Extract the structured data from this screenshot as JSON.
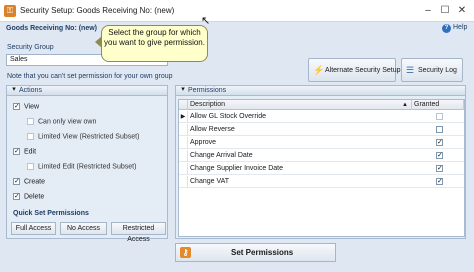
{
  "window": {
    "title": "Security Setup: Goods Receiving No: (new)",
    "app_icon": "security-app-icon",
    "controls": {
      "minimize": "–",
      "maximize": "☐",
      "close": "✕"
    }
  },
  "header": {
    "label": "Goods Receiving No: (new)",
    "help_label": "Help"
  },
  "security_group": {
    "label": "Security Group",
    "value": "Sales",
    "note": "Note that you can't set permission for your own group"
  },
  "tooltip": {
    "text": "Select the group for which you want to give permission."
  },
  "toolbar": {
    "alternate_security_label": "Alternate Security Setup",
    "security_log_label": "Security Log"
  },
  "actions": {
    "title": "Actions",
    "items": [
      {
        "label": "View",
        "checked": true
      },
      {
        "label": "Can only view own",
        "checked": false
      },
      {
        "label": "Limited View (Restricted Subset)",
        "checked": false
      },
      {
        "label": "Edit",
        "checked": true
      },
      {
        "label": "Limited Edit (Restricted Subset)",
        "checked": false
      },
      {
        "label": "Create",
        "checked": true
      },
      {
        "label": "Delete",
        "checked": true
      }
    ],
    "quick_set_label": "Quick Set Permissions",
    "quick_set_buttons": [
      "Full Access",
      "No Access",
      "Restricted Access"
    ]
  },
  "permissions": {
    "title": "Permissions",
    "columns": [
      "Description",
      "Granted"
    ],
    "rows": [
      {
        "description": "Allow GL Stock Override",
        "granted": false,
        "current": true
      },
      {
        "description": "Allow Reverse",
        "granted": false,
        "current": false
      },
      {
        "description": "Approve",
        "granted": true,
        "current": false
      },
      {
        "description": "Change Arrival Date",
        "granted": true,
        "current": false
      },
      {
        "description": "Change Supplier Invoice Date",
        "granted": true,
        "current": false
      },
      {
        "description": "Change VAT",
        "granted": true,
        "current": false
      }
    ]
  },
  "set_permissions_label": "Set Permissions"
}
